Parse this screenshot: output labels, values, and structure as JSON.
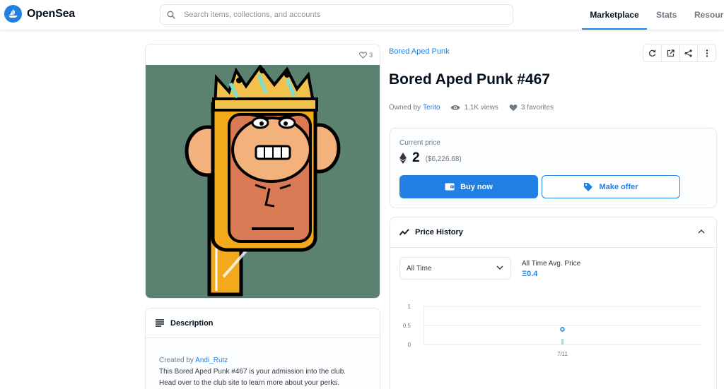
{
  "app": {
    "name": "OpenSea"
  },
  "search": {
    "placeholder": "Search items, collections, and accounts"
  },
  "nav": {
    "marketplace": "Marketplace",
    "stats": "Stats",
    "resources": "Resourc"
  },
  "item": {
    "favorites_count": "3",
    "collection": "Bored Aped Punk",
    "title": "Bored Aped Punk #467",
    "owned_by_label": "Owned by",
    "owner": "Terito",
    "views": "1.1K views",
    "favorites": "3 favorites"
  },
  "price": {
    "label": "Current price",
    "eth": "2",
    "usd": "($6,226.68)",
    "buy_label": "Buy now",
    "offer_label": "Make offer"
  },
  "history": {
    "title": "Price History",
    "range_selected": "All Time",
    "avg_label": "All Time Avg. Price",
    "avg_value": "Ξ0.4"
  },
  "chart_data": {
    "type": "scatter",
    "x": [
      "7/11"
    ],
    "y": [
      0.4
    ],
    "yticks": [
      "1",
      "0.5",
      "0"
    ],
    "xticks": [
      "7/11"
    ],
    "ylim": [
      0,
      1
    ]
  },
  "description": {
    "title": "Description",
    "created_by_label": "Created by",
    "creator": "Andi_Rutz",
    "line1": "This Bored Aped Punk #467 is your admission into the club.",
    "line2": "Head over to the club site to learn more about your perks."
  },
  "colors": {
    "accent": "#2081e2",
    "art_background": "#5b8170"
  }
}
